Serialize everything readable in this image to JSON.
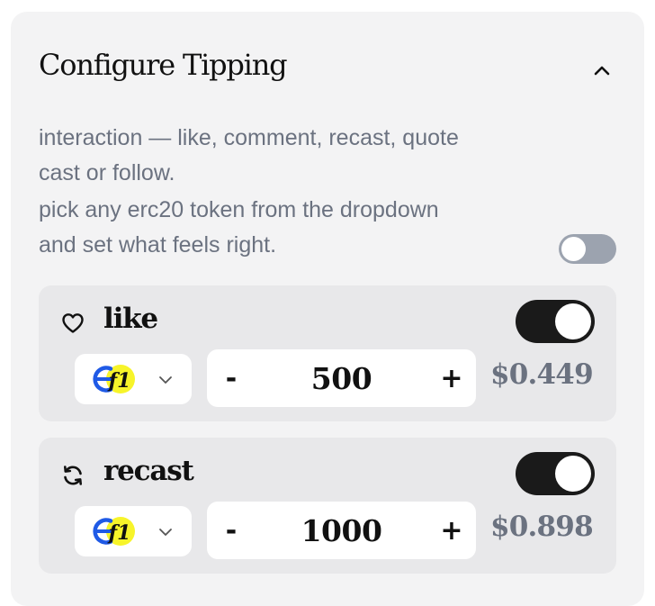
{
  "title": "Configure Tipping",
  "description_lines": [
    "interaction — like, comment, recast, quote",
    "cast or follow.",
    "pick any erc20 token from the dropdown",
    "and set what feels right."
  ],
  "master_toggle": {
    "on": false,
    "track_color": "#9ca3af"
  },
  "icons": {
    "collapse": "chevron-up-icon",
    "like": "heart-icon",
    "recast": "refresh-icon",
    "token": "token-logo-icon",
    "token_dropdown": "chevron-down-icon"
  },
  "colors": {
    "toggle_on": "#1a1a1a",
    "token_blue": "#1f5ae6",
    "token_yellow": "#f7f42a",
    "usd_text": "#6b7280"
  },
  "interactions": [
    {
      "label": "like",
      "enabled": true,
      "minus_label": "-",
      "amount": "500",
      "plus_label": "+",
      "usd": "$0.449"
    },
    {
      "label": "recast",
      "enabled": true,
      "minus_label": "-",
      "amount": "1000",
      "plus_label": "+",
      "usd": "$0.898"
    }
  ]
}
